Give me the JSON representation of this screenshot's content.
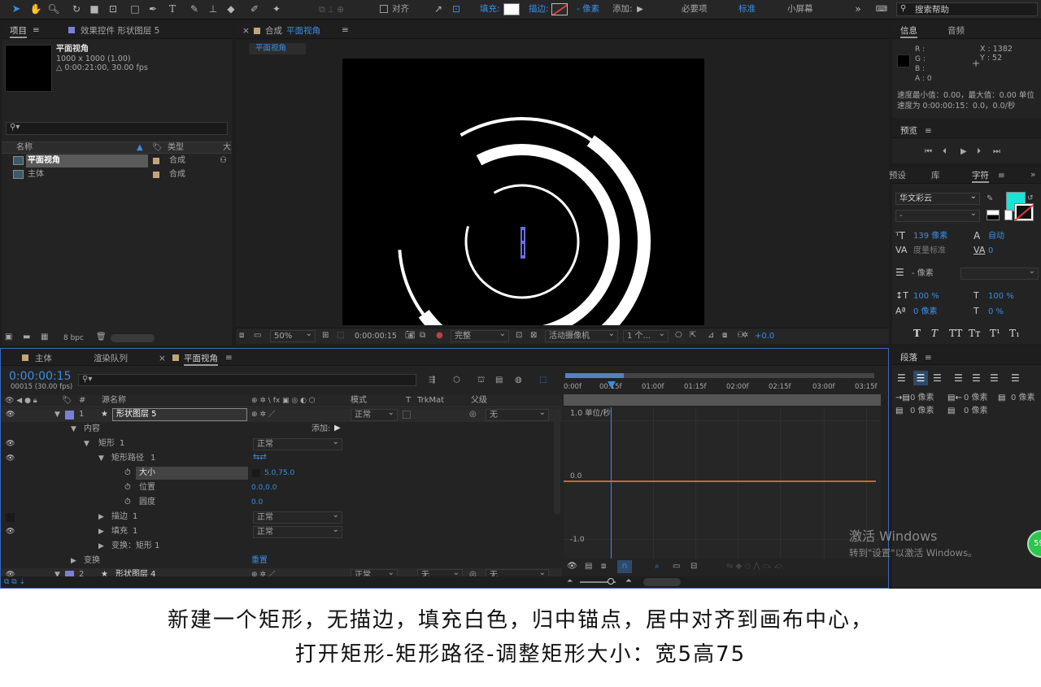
{
  "toolbar": {
    "align": "对齐",
    "fill": "填充:",
    "stroke": "描边:",
    "stroke_width": "- 像素",
    "add": "添加:",
    "workspaces": [
      "必要项",
      "标准",
      "小屏幕"
    ],
    "active_workspace": "标准",
    "search_placeholder": "搜索帮助",
    "fill_color": "#ffffff",
    "accent": "#3a8ee6"
  },
  "project": {
    "tab": "项目",
    "effects_tab": "效果控件 形状图层 5",
    "comp_name": "平面视角",
    "comp_size": "1000 x 1000 (1.00)",
    "comp_duration": "△ 0:00:21:00, 30.00 fps",
    "col_name": "名称",
    "col_type": "类型",
    "col_size": "大",
    "items": [
      {
        "name": "平面视角",
        "type": "合成",
        "selected": true
      },
      {
        "name": "主体",
        "type": "合成",
        "selected": false
      }
    ],
    "bpc": "8 bpc"
  },
  "viewer": {
    "tab_prefix": "合成",
    "tab_name": "平面视角",
    "breadcrumb": "平面视角",
    "zoom": "50%",
    "timecode": "0:00:00:15",
    "quality": "完整",
    "camera": "活动摄像机",
    "views": "1 个...",
    "exposure": "+0.0"
  },
  "info": {
    "tab": "信息",
    "audio_tab": "音频",
    "r": "R :",
    "g": "G :",
    "b": "B :",
    "a": "A : 0",
    "x": "X : 1382",
    "y": "Y : 52",
    "speed_min": "速度最小值：0.00，最大值：0.00 单位",
    "speed_at": "速度为 0:00:00:15：0.0，0.0/秒"
  },
  "preview": {
    "tab": "预览"
  },
  "char": {
    "tabs": [
      "预设",
      "库",
      "字符"
    ],
    "active_tab": "字符",
    "font": "华文彩云",
    "style": "-",
    "size": "139 像素",
    "leading": "自动",
    "kerning": "度量标准",
    "tracking": "0",
    "stroke_w": "- 像素",
    "v_scale": "100 %",
    "h_scale": "100 %",
    "baseline": "0 像素",
    "tsume": "0 %",
    "color": "#19e3d6",
    "styles": [
      "T",
      "T",
      "TT",
      "Tт",
      "T¹",
      "T₁"
    ]
  },
  "para": {
    "tab": "段落",
    "indents": [
      "0 像素",
      "0 像素",
      "0 像素",
      "0 像素",
      "0 像素"
    ]
  },
  "timeline": {
    "tabs": [
      "主体",
      "渲染队列",
      "平面视角"
    ],
    "active_tab": "平面视角",
    "timecode": "0:00:00:15",
    "fps": "00015 (30.00 fps)",
    "col_source": "源名称",
    "col_mode": "模式",
    "col_t": "T",
    "col_trkmat": "TrkMat",
    "col_parent": "父级",
    "ruler": [
      "0:00f",
      "00:15f",
      "01:00f",
      "01:15f",
      "02:00f",
      "02:15f",
      "03:00f",
      "03:15f"
    ],
    "graph_labels": [
      "1.0 单位/秒",
      "0.0",
      "-1.0"
    ],
    "layers": [
      {
        "num": "1",
        "name": "形状图层 5",
        "mode": "正常",
        "parent": "无"
      },
      {
        "name": "内容",
        "add": "添加:"
      },
      {
        "num": "1",
        "name": "矩形",
        "mode": "正常"
      },
      {
        "num": "1",
        "name": "矩形路径"
      },
      {
        "name": "大小",
        "value": "5.0,75.0"
      },
      {
        "name": "位置",
        "value": "0.0,0.0"
      },
      {
        "name": "圆度",
        "value": "0.0"
      },
      {
        "num": "1",
        "name": "描边",
        "mode": "正常"
      },
      {
        "num": "1",
        "name": "填充",
        "mode": "正常"
      },
      {
        "name": "变换：矩形 1"
      },
      {
        "name": "变换",
        "value": "重置"
      },
      {
        "num": "2",
        "name": "形状图层 4",
        "mode": "正常",
        "trkmat": "无",
        "parent": "无"
      }
    ]
  },
  "watermark": {
    "title": "激活 Windows",
    "sub": "转到\"设置\"以激活 Windows。"
  },
  "badge": "59",
  "caption": {
    "line1": "新建一个矩形，无描边，填充白色，归中锚点，居中对齐到画布中心，",
    "line2": "打开矩形-矩形路径-调整矩形大小：宽5高75"
  }
}
